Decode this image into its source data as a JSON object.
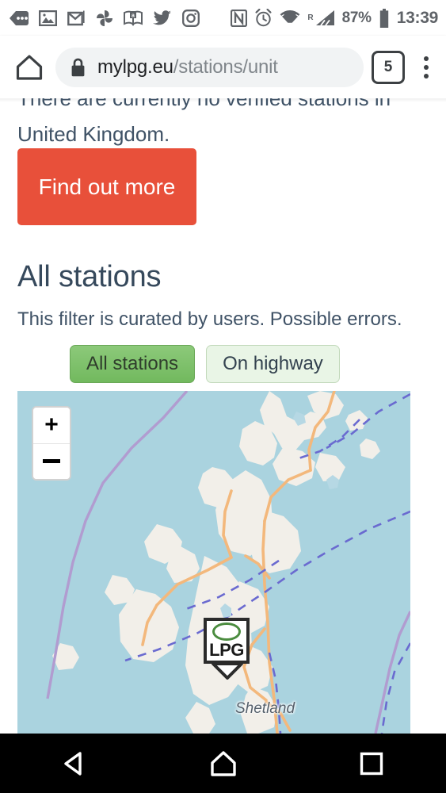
{
  "statusbar": {
    "icons_left": [
      "more-notifications-icon",
      "photo-icon",
      "gmail-icon",
      "google-photos-icon",
      "book-icon",
      "twitter-icon",
      "instagram-icon"
    ],
    "icons_right": [
      "nfc-icon",
      "alarm-icon",
      "wifi-icon",
      "cellular-signal-icon",
      "battery-icon"
    ],
    "roaming_label": "R",
    "battery_percent": "87%",
    "clock": "13:39"
  },
  "browser": {
    "home_icon": "home-icon",
    "lock_icon": "lock-icon",
    "url_domain": "mylpg.eu",
    "url_path": "/stations/unit",
    "tab_count": "5",
    "menu_icon": "kebab-menu-icon"
  },
  "content": {
    "notice": "There are currently no verified stations in United Kingdom.",
    "find_out_more_label": "Find out more",
    "heading": "All stations",
    "subtitle": "This filter is curated by users. Possible errors.",
    "filters": [
      {
        "label": "All stations",
        "state": "active"
      },
      {
        "label": "On highway",
        "state": "inactive"
      }
    ]
  },
  "map": {
    "zoom_in_label": "+",
    "zoom_out_label": "−",
    "marker_label": "LPG",
    "place_label": "Shetland",
    "colors": {
      "sea": "#aad3df",
      "land": "#f2efe9",
      "road": "#f3b87c",
      "boundary": "#b19cd0",
      "maritime_boundary": "#6a6ad0"
    }
  },
  "navbar": {
    "back_icon": "back-triangle-icon",
    "home_icon": "home-icon",
    "recents_icon": "recents-square-icon"
  },
  "colors": {
    "accent_red": "#e8503a",
    "heading": "#36495c",
    "body_text": "#3f5266",
    "filter_active": "#72b95e",
    "filter_inactive": "#e9f5e6"
  }
}
